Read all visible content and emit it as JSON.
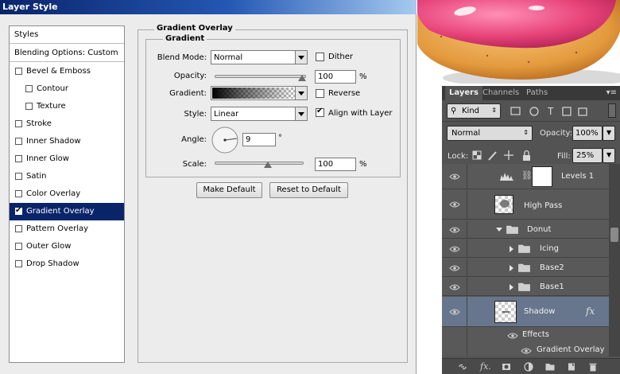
{
  "dialog": {
    "title": "Layer Style",
    "styles_header": "Styles",
    "blending_options": "Blending Options: Custom",
    "style_items": [
      {
        "label": "Bevel & Emboss",
        "checked": false,
        "indent": false
      },
      {
        "label": "Contour",
        "checked": false,
        "indent": true
      },
      {
        "label": "Texture",
        "checked": false,
        "indent": true
      },
      {
        "label": "Stroke",
        "checked": false,
        "indent": false
      },
      {
        "label": "Inner Shadow",
        "checked": false,
        "indent": false
      },
      {
        "label": "Inner Glow",
        "checked": false,
        "indent": false
      },
      {
        "label": "Satin",
        "checked": false,
        "indent": false
      },
      {
        "label": "Color Overlay",
        "checked": false,
        "indent": false
      },
      {
        "label": "Gradient Overlay",
        "checked": true,
        "indent": false,
        "selected": true
      },
      {
        "label": "Pattern Overlay",
        "checked": false,
        "indent": false
      },
      {
        "label": "Outer Glow",
        "checked": false,
        "indent": false
      },
      {
        "label": "Drop Shadow",
        "checked": false,
        "indent": false
      }
    ],
    "panel": {
      "group_title": "Gradient Overlay",
      "subgroup_title": "Gradient",
      "blend_mode_label": "Blend Mode:",
      "blend_mode_value": "Normal",
      "dither_label": "Dither",
      "dither_checked": false,
      "opacity_label": "Opacity:",
      "opacity_value": "100",
      "opacity_fraction": 1.0,
      "opacity_unit": "%",
      "gradient_label": "Gradient:",
      "reverse_label": "Reverse",
      "reverse_checked": false,
      "style_label": "Style:",
      "style_value": "Linear",
      "align_label": "Align with Layer",
      "align_checked": true,
      "angle_label": "Angle:",
      "angle_value": "9",
      "angle_unit": "°",
      "scale_label": "Scale:",
      "scale_value": "100",
      "scale_fraction": 0.5,
      "scale_unit": "%",
      "make_default": "Make Default",
      "reset_default": "Reset to Default"
    }
  },
  "layers_panel": {
    "tabs": [
      "Layers",
      "Channels",
      "Paths"
    ],
    "active_tab": "Layers",
    "filter_kind": "Kind",
    "blend_mode": "Normal",
    "opacity_label": "Opacity:",
    "opacity_value": "100%",
    "lock_label": "Lock:",
    "fill_label": "Fill:",
    "fill_value": "25%",
    "layers": [
      {
        "name": "Levels 1"
      },
      {
        "name": "High Pass"
      },
      {
        "name": "Donut"
      },
      {
        "name": "Icing"
      },
      {
        "name": "Base2"
      },
      {
        "name": "Base1"
      },
      {
        "name": "Shadow",
        "fx": "fx"
      }
    ],
    "effects_label": "Effects",
    "effect_item": "Gradient Overlay"
  },
  "colors": {
    "title_bar": "#0a246a",
    "selection": "#0a246a",
    "ps_panel": "#535353",
    "ps_selected_layer": "#67768d",
    "icing": "#e8447a",
    "dough": "#e8a04a"
  }
}
